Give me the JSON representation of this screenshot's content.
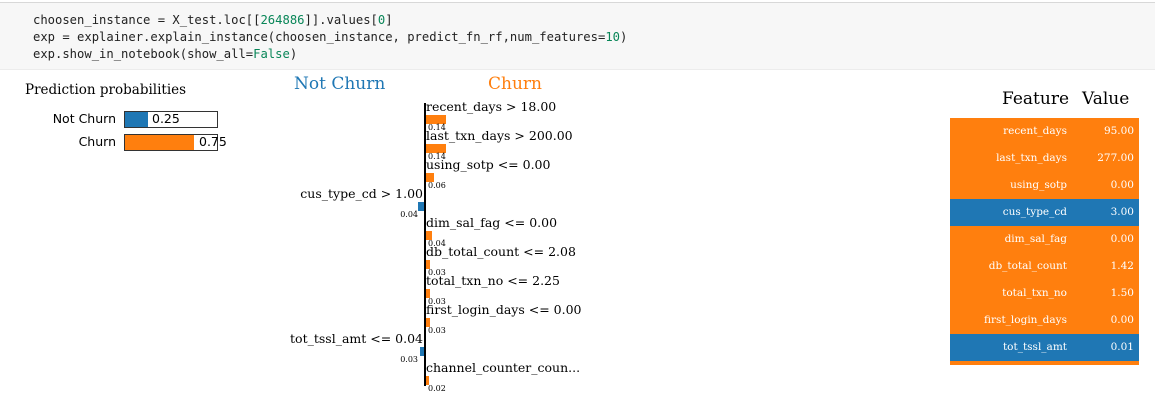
{
  "colors": {
    "churn": "#ff7f0e",
    "not_churn": "#1f77b4"
  },
  "code": {
    "line1": [
      "choosen_instance = X_test.loc[[",
      "264886",
      "]].values[",
      "0",
      "]"
    ],
    "line2": [
      "exp = explainer.explain_instance(choosen_instance, predict_fn_rf,num_features=",
      "10",
      ")"
    ],
    "line3": [
      "exp.show_in_notebook(show_all=",
      "False",
      ")"
    ]
  },
  "probabilities": {
    "title": "Prediction probabilities",
    "items": [
      {
        "label": "Not Churn",
        "value": 0.25,
        "value_text": "0.25",
        "color": "#1f77b4"
      },
      {
        "label": "Churn",
        "value": 0.75,
        "value_text": "0.75",
        "color": "#ff7f0e"
      }
    ]
  },
  "explanation": {
    "left_class": "Not Churn",
    "right_class": "Churn",
    "features": [
      {
        "label": "recent_days > 18.00",
        "weight": 0.14,
        "weight_text": "0.14",
        "side": "right"
      },
      {
        "label": "last_txn_days > 200.00",
        "weight": 0.14,
        "weight_text": "0.14",
        "side": "right"
      },
      {
        "label": "using_sotp <= 0.00",
        "weight": 0.06,
        "weight_text": "0.06",
        "side": "right"
      },
      {
        "label": "cus_type_cd > 1.00",
        "weight": 0.04,
        "weight_text": "0.04",
        "side": "left"
      },
      {
        "label": "dim_sal_fag <= 0.00",
        "weight": 0.04,
        "weight_text": "0.04",
        "side": "right"
      },
      {
        "label": "db_total_count <= 2.08",
        "weight": 0.03,
        "weight_text": "0.03",
        "side": "right"
      },
      {
        "label": "total_txn_no <= 2.25",
        "weight": 0.03,
        "weight_text": "0.03",
        "side": "right"
      },
      {
        "label": "first_login_days <= 0.00",
        "weight": 0.03,
        "weight_text": "0.03",
        "side": "right"
      },
      {
        "label": "tot_tssl_amt <= 0.04",
        "weight": 0.03,
        "weight_text": "0.03",
        "side": "left"
      },
      {
        "label": "channel_counter_coun...",
        "weight": 0.02,
        "weight_text": "0.02",
        "side": "right"
      }
    ]
  },
  "table": {
    "header_feature": "Feature",
    "header_value": "Value",
    "rows": [
      {
        "feature": "recent_days",
        "value": "95.00",
        "class": "churn"
      },
      {
        "feature": "last_txn_days",
        "value": "277.00",
        "class": "churn"
      },
      {
        "feature": "using_sotp",
        "value": "0.00",
        "class": "churn"
      },
      {
        "feature": "cus_type_cd",
        "value": "3.00",
        "class": "not_churn"
      },
      {
        "feature": "dim_sal_fag",
        "value": "0.00",
        "class": "churn"
      },
      {
        "feature": "db_total_count",
        "value": "1.42",
        "class": "churn"
      },
      {
        "feature": "total_txn_no",
        "value": "1.50",
        "class": "churn"
      },
      {
        "feature": "first_login_days",
        "value": "0.00",
        "class": "churn"
      },
      {
        "feature": "tot_tssl_amt",
        "value": "0.01",
        "class": "not_churn"
      }
    ]
  }
}
